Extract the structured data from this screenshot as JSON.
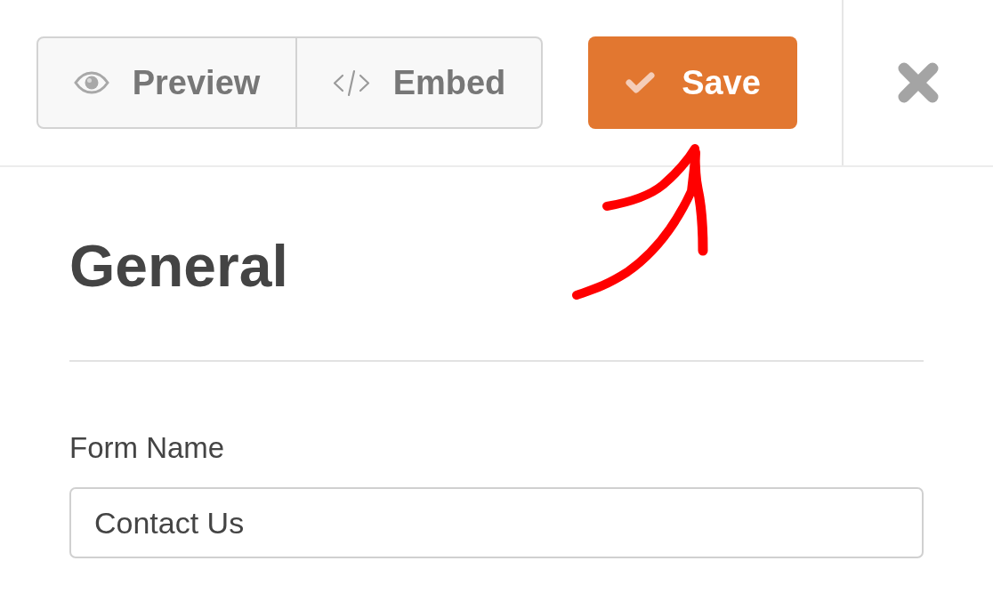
{
  "toolbar": {
    "buttons": [
      {
        "kind": "preview",
        "label": "Preview"
      },
      {
        "kind": "embed",
        "label": "Embed"
      }
    ],
    "save_button": {
      "label": "Save"
    }
  },
  "panel": {
    "title": "General",
    "fields": [
      {
        "label": "Form Name",
        "value": "Contact Us"
      }
    ]
  }
}
